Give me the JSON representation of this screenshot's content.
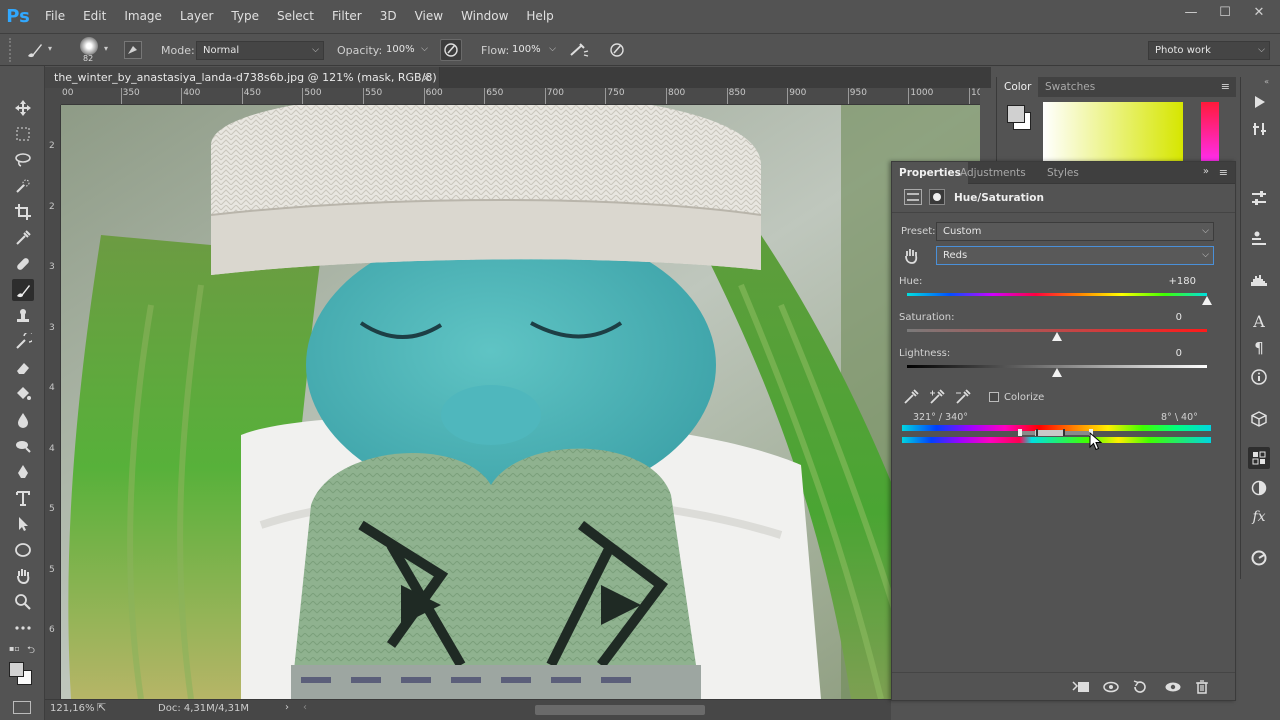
{
  "app": {
    "logo": "Ps"
  },
  "menu": [
    "File",
    "Edit",
    "Image",
    "Layer",
    "Type",
    "Select",
    "Filter",
    "3D",
    "View",
    "Window",
    "Help"
  ],
  "window_controls": {
    "minimize": "—",
    "maximize": "☐",
    "close": "✕"
  },
  "options": {
    "brush_size": "82",
    "mode_label": "Mode:",
    "mode_value": "Normal",
    "opacity_label": "Opacity:",
    "opacity_value": "100%",
    "flow_label": "Flow:",
    "flow_value": "100%",
    "workspace": "Photo work"
  },
  "document": {
    "tab_title": "the_winter_by_anastasiya_landa-d738s6b.jpg @ 121% (mask, RGB/8) *",
    "close": "×",
    "zoom": "121,16%",
    "doc_size": "Doc: 4,31M/4,31M"
  },
  "ruler": {
    "h_labels": [
      "00",
      "350",
      "400",
      "450",
      "500",
      "550",
      "600",
      "650",
      "700",
      "750",
      "800",
      "850",
      "900",
      "950",
      "1000",
      "10"
    ],
    "v_labels": [
      "2",
      "2",
      "3",
      "3",
      "4",
      "4",
      "5",
      "5",
      "6"
    ]
  },
  "color_panel": {
    "tabs": [
      "Color",
      "Swatches"
    ],
    "active": "Color"
  },
  "properties": {
    "tabs": [
      "Properties",
      "Adjustments",
      "Styles"
    ],
    "active": "Properties",
    "title": "Hue/Saturation",
    "preset_label": "Preset:",
    "preset_value": "Custom",
    "channel_value": "Reds",
    "hue_label": "Hue:",
    "hue_value": "+180",
    "saturation_label": "Saturation:",
    "saturation_value": "0",
    "lightness_label": "Lightness:",
    "lightness_value": "0",
    "colorize_label": "Colorize",
    "colorize_checked": false,
    "range_left": "321° /  340°",
    "range_right": "8°  \\  40°",
    "hue_level": 1.0,
    "saturation_level": 0.5,
    "lightness_level": 0.5
  },
  "icons": {
    "tools": [
      "move-icon",
      "marquee-icon",
      "lasso-icon",
      "quick-select-icon",
      "crop-icon",
      "eyedropper-icon",
      "healing-icon",
      "brush-icon",
      "stamp-icon",
      "history-brush-icon",
      "eraser-icon",
      "bucket-icon",
      "blur-icon",
      "dodge-icon",
      "pen-icon",
      "type-icon",
      "path-select-icon",
      "ellipse-icon",
      "hand-icon",
      "zoom-icon",
      "more-icon"
    ],
    "right_strip": [
      "play-icon",
      "history-icon",
      "adjust-icon",
      "layer-comps-icon",
      "histogram-icon",
      "character-icon",
      "paragraph-icon",
      "info-icon",
      "3d-icon",
      "properties-icon",
      "styles-icon",
      "fx-icon",
      "timeline-icon"
    ]
  }
}
